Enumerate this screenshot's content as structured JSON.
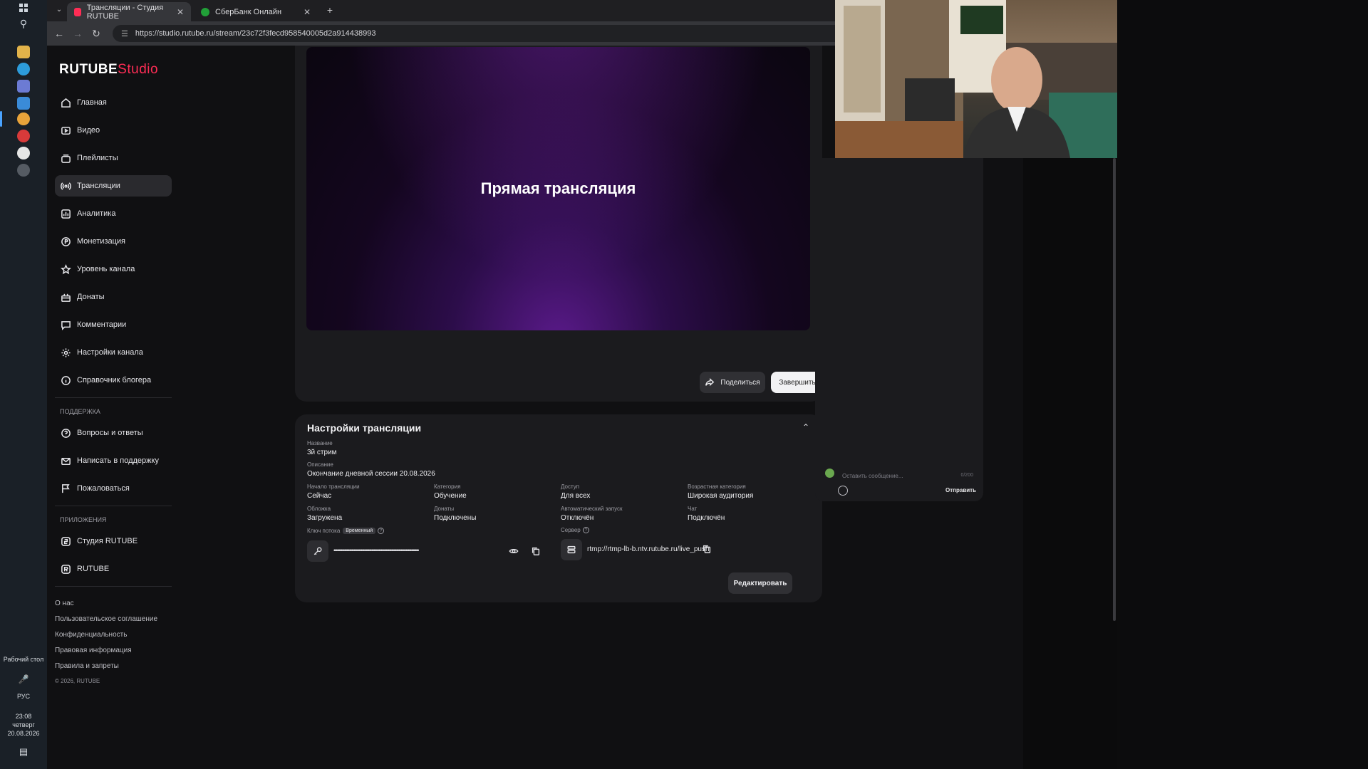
{
  "taskbar": {
    "desktop_label": "Рабочий стол",
    "lang": "РУС",
    "time": "23:08",
    "day": "четверг",
    "date": "20.08.2026"
  },
  "browser": {
    "tabs": [
      {
        "title": "Трансляции - Студия RUTUBE",
        "active": true
      },
      {
        "title": "СберБанк Онлайн",
        "active": false
      }
    ],
    "url": "https://studio.rutube.ru/stream/23c72f3fecd958540005d2a914438993"
  },
  "logo": {
    "main": "RUTUBE",
    "accent": "Studio"
  },
  "sidebar": {
    "items": [
      {
        "label": "Главная",
        "icon": "home-icon"
      },
      {
        "label": "Видео",
        "icon": "video-icon"
      },
      {
        "label": "Плейлисты",
        "icon": "playlist-icon"
      },
      {
        "label": "Трансляции",
        "icon": "broadcast-icon",
        "active": true
      },
      {
        "label": "Аналитика",
        "icon": "analytics-icon"
      },
      {
        "label": "Монетизация",
        "icon": "ruble-icon"
      },
      {
        "label": "Уровень канала",
        "icon": "star-icon"
      },
      {
        "label": "Донаты",
        "icon": "gift-icon"
      },
      {
        "label": "Комментарии",
        "icon": "comment-icon"
      },
      {
        "label": "Настройки канала",
        "icon": "gear-icon"
      },
      {
        "label": "Справочник блогера",
        "icon": "info-icon"
      }
    ],
    "support_label": "ПОДДЕРЖКА",
    "support_items": [
      {
        "label": "Вопросы и ответы",
        "icon": "question-icon"
      },
      {
        "label": "Написать в поддержку",
        "icon": "mail-icon"
      },
      {
        "label": "Пожаловаться",
        "icon": "flag-icon"
      }
    ],
    "apps_label": "ПРИЛОЖЕНИЯ",
    "apps_items": [
      {
        "label": "Студия RUTUBE",
        "icon": "studio-icon"
      },
      {
        "label": "RUTUBE",
        "icon": "rutube-icon"
      }
    ],
    "footer_links": [
      "О нас",
      "Пользовательское соглашение",
      "Конфиденциальность",
      "Правовая информация",
      "Правила и запреты"
    ],
    "copyright": "© 2026, RUTUBE"
  },
  "player": {
    "title": "Прямая трансляция",
    "share_label": "Поделиться",
    "finish_label": "Завершить"
  },
  "settings": {
    "title": "Настройки трансляции",
    "name_label": "Название",
    "name_value": "3й стрим",
    "desc_label": "Описание",
    "desc_value": "Окончание дневной сессии 20.08.2026",
    "start_label": "Начало трансляции",
    "start_value": "Сейчас",
    "category_label": "Категория",
    "category_value": "Обучение",
    "access_label": "Доступ",
    "access_value": "Для всех",
    "age_label": "Возрастная категория",
    "age_value": "Широкая аудитория",
    "cover_label": "Обложка",
    "cover_value": "Загружена",
    "donates_label": "Донаты",
    "donates_value": "Подключены",
    "autostart_label": "Автоматический запуск",
    "autostart_value": "Отключён",
    "chat_label": "Чат",
    "chat_value": "Подключён",
    "key_label": "Ключ потока",
    "key_badge": "Временный",
    "key_value": "••••••••••••••••••••••••••••••••••••••••••••••••••••••••••••••••••••••••",
    "server_label": "Сервер",
    "server_value": "rtmp://rtmp-lb-b.ntv.rutube.ru/live_push",
    "edit_label": "Редактировать"
  },
  "chat": {
    "placeholder": "Оставить сообщение...",
    "counter": "0/200",
    "send_label": "Отправить"
  },
  "colors": {
    "accent": "#ff2d55",
    "background": "#101012",
    "card": "#1b1b1e"
  }
}
